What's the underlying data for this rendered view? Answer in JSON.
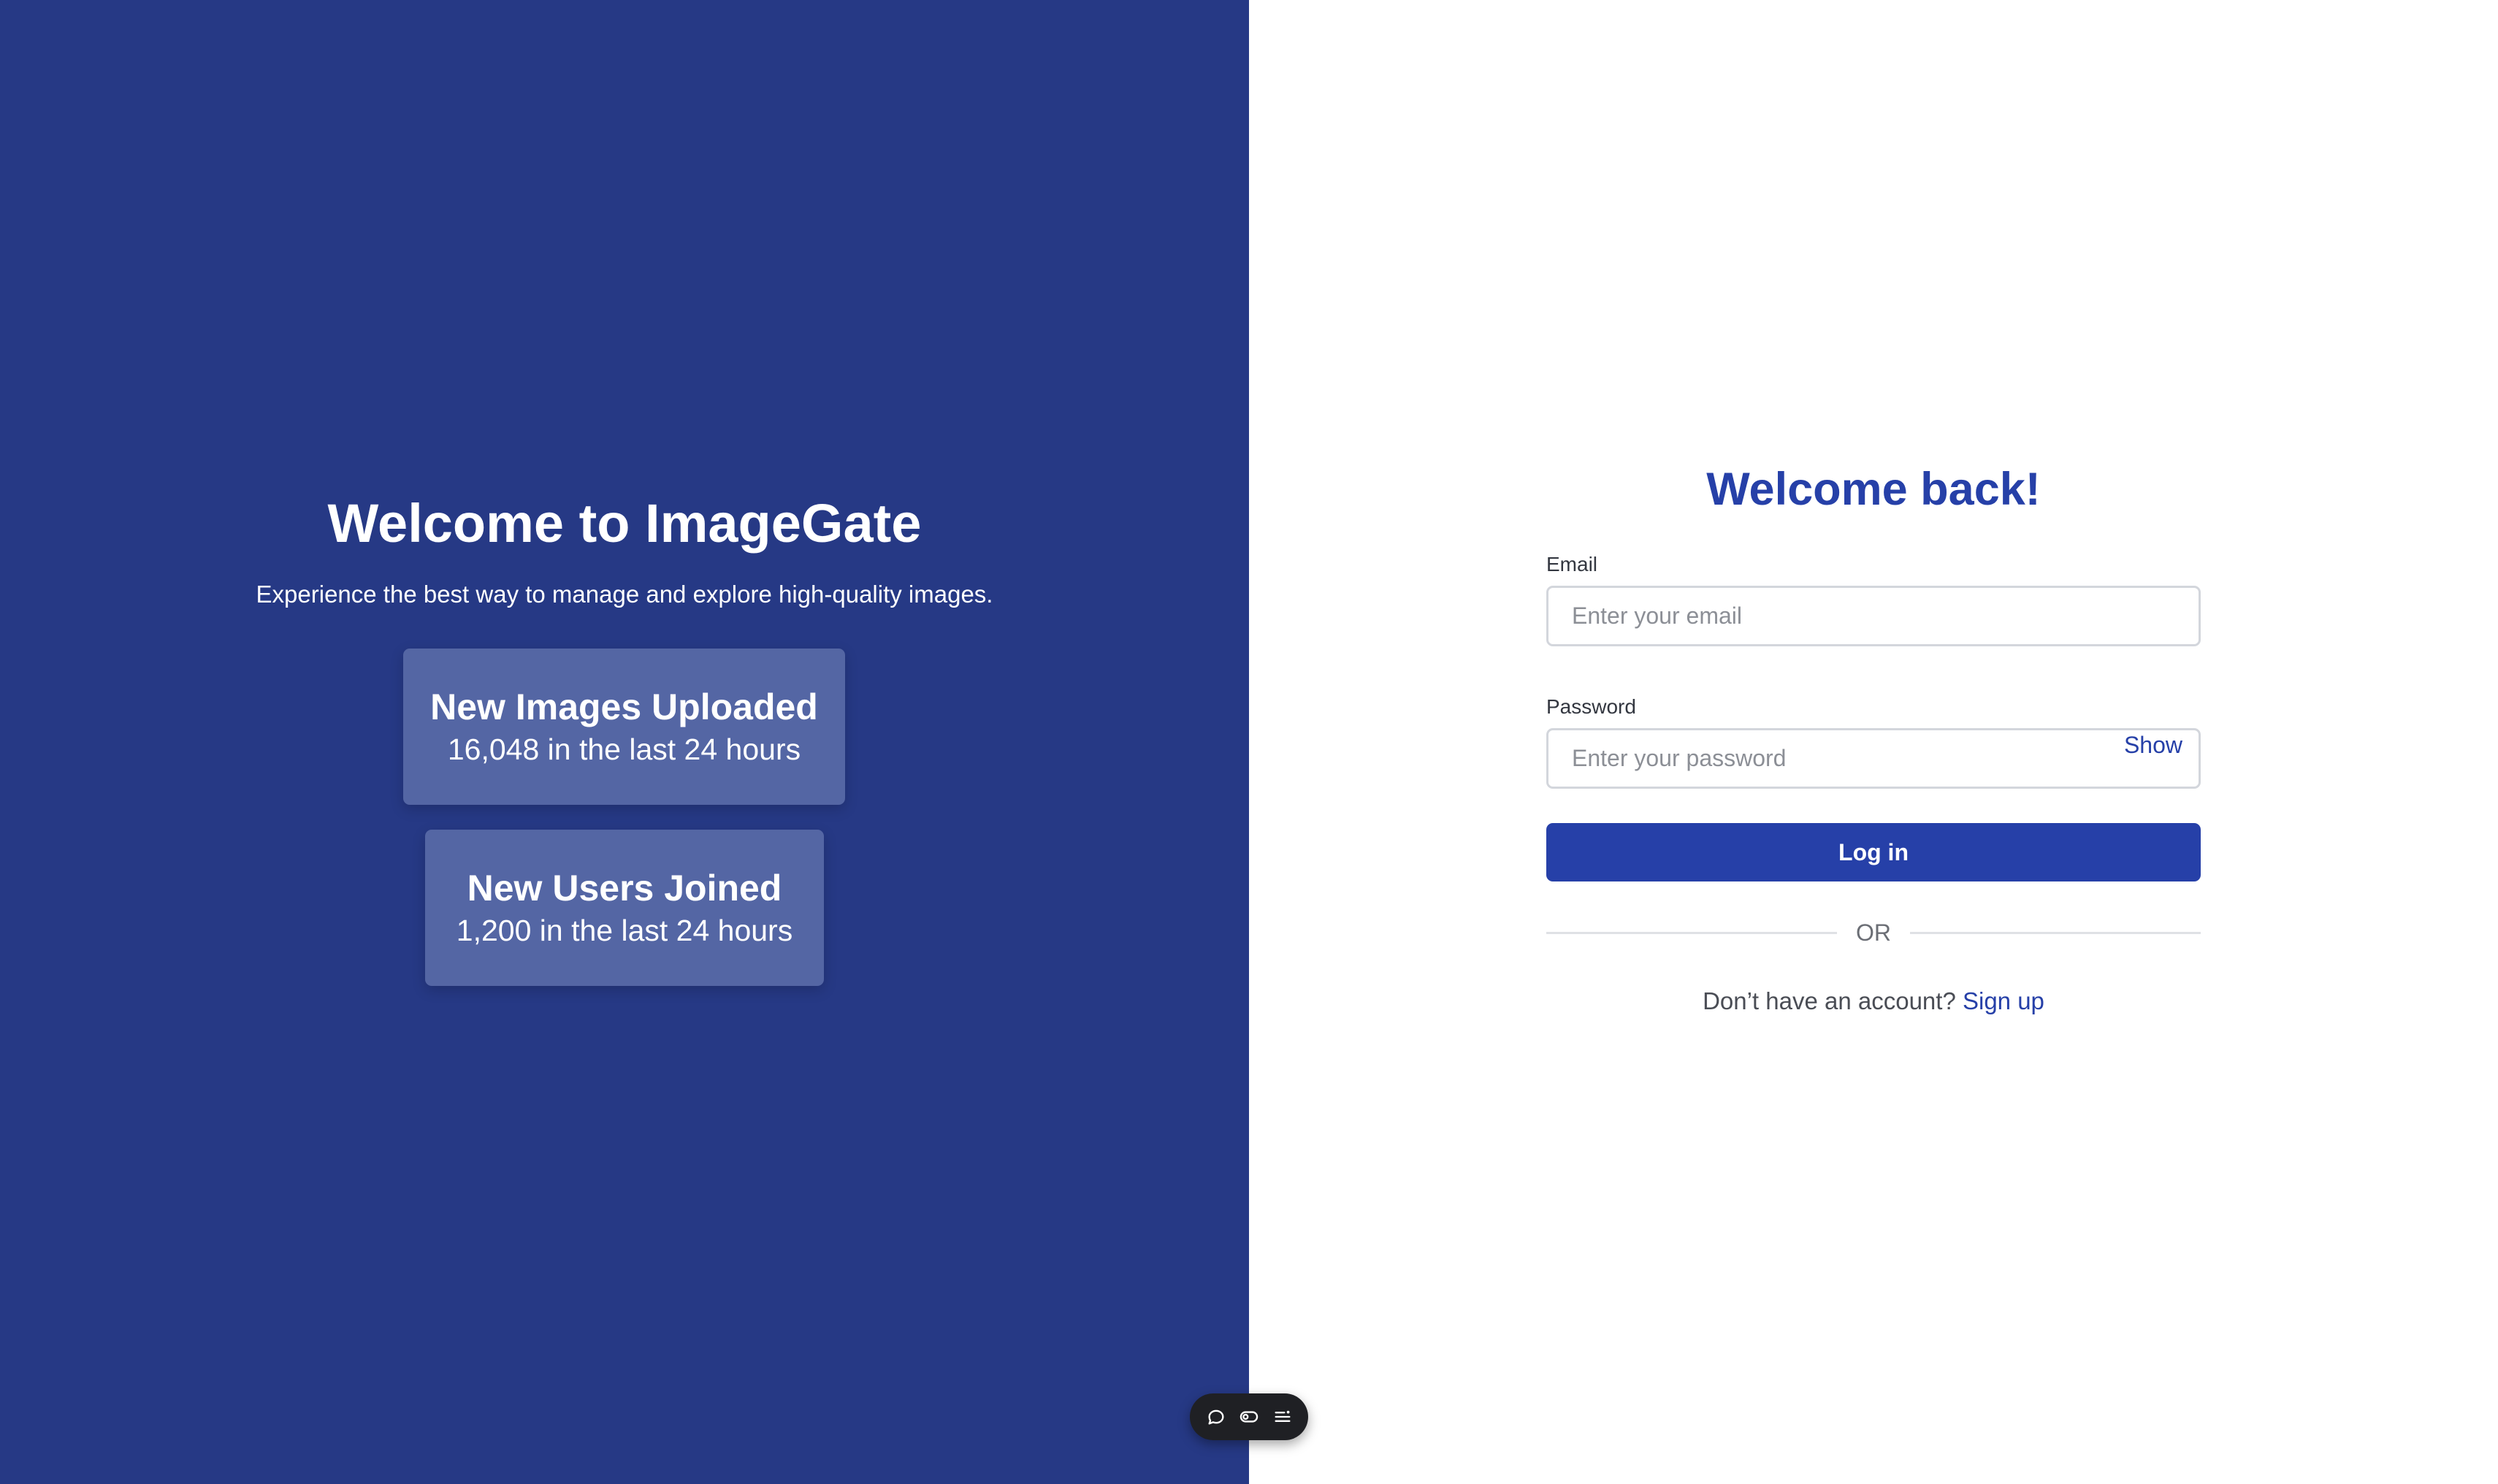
{
  "hero": {
    "title": "Welcome to ImageGate",
    "subtitle": "Experience the best way to manage and explore high-quality images."
  },
  "stats": [
    {
      "title": "New Images Uploaded",
      "value": "16,048 in the last 24 hours"
    },
    {
      "title": "New Users Joined",
      "value": "1,200 in the last 24 hours"
    }
  ],
  "login": {
    "title": "Welcome back!",
    "email": {
      "label": "Email",
      "value": "",
      "placeholder": "Enter your email"
    },
    "password": {
      "label": "Password",
      "value": "",
      "placeholder": "Enter your password",
      "toggle": "Show"
    },
    "submit": "Log in",
    "divider": "OR",
    "signup_prompt": "Don’t have an account?",
    "signup_link": "Sign up"
  },
  "toolbar": {
    "icons": [
      "chat-icon",
      "toggle-icon",
      "menu-icon"
    ]
  },
  "colors": {
    "left_panel_bg": "#263985",
    "stat_card_bg": "#5466a4",
    "accent": "#2640a8",
    "toolbar_bg": "#1f2024"
  }
}
